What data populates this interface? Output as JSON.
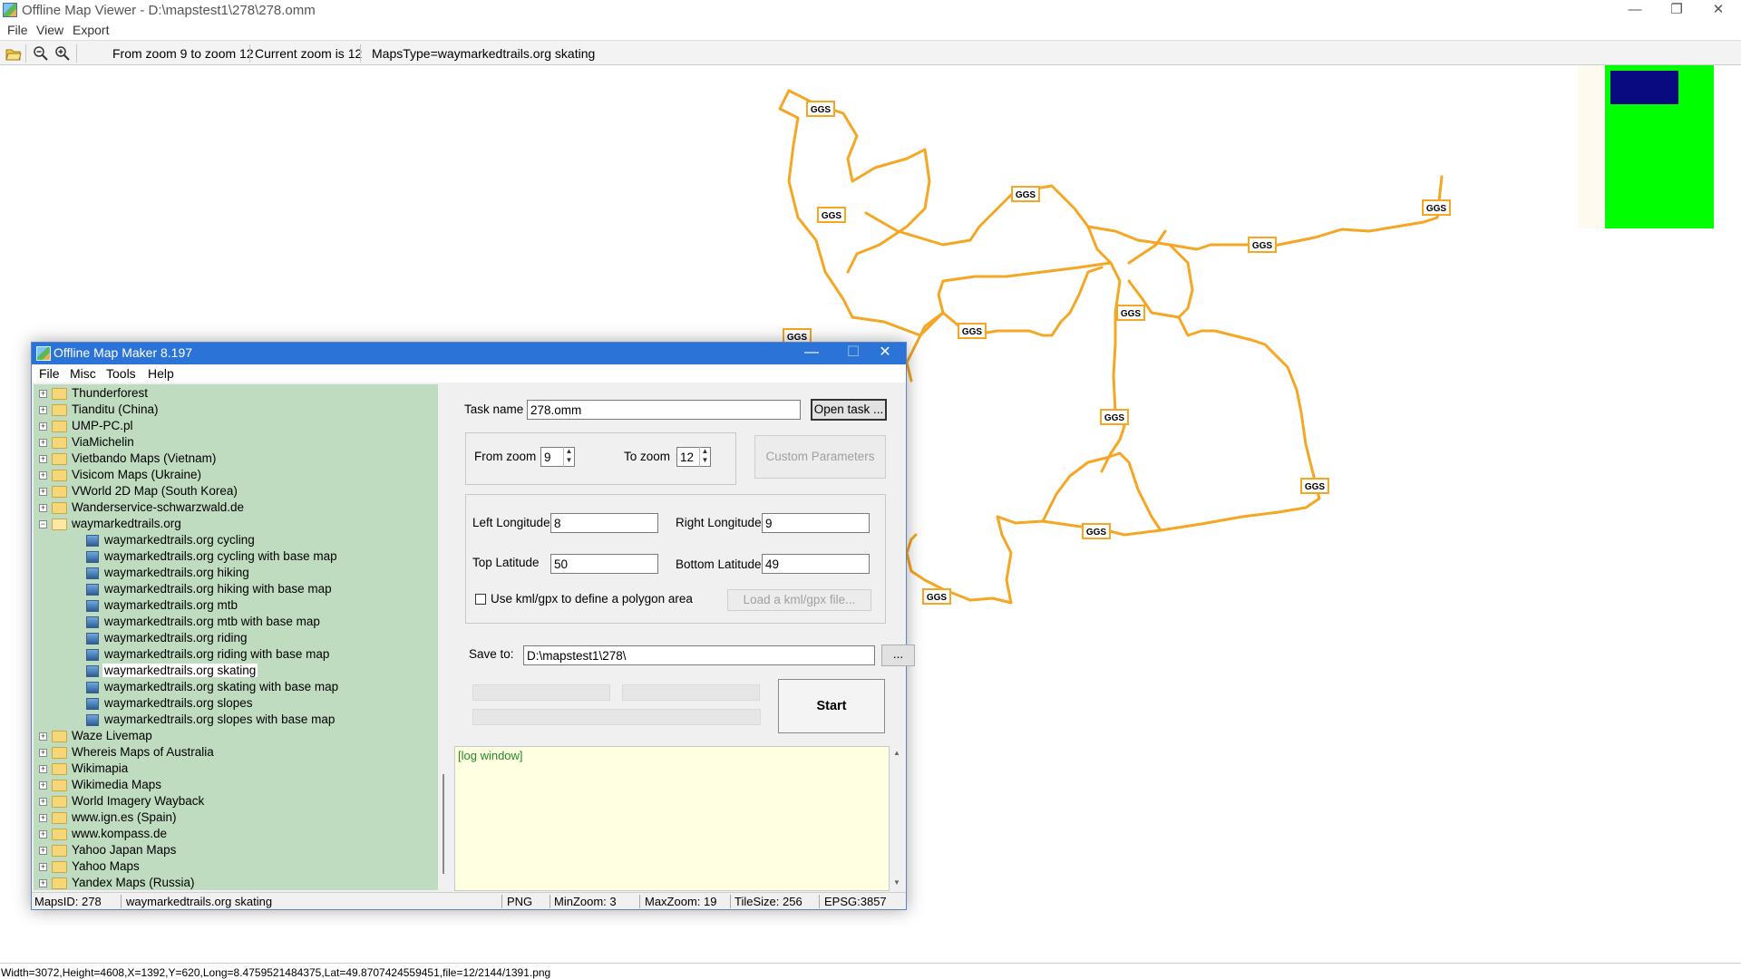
{
  "viewer": {
    "title": "Offline Map Viewer - D:\\mapstest1\\278\\278.omm",
    "menu": [
      "File",
      "View",
      "Export"
    ],
    "toolbar_info": {
      "zoom_range": "From zoom 9 to zoom 12",
      "current_zoom": "Current zoom is 12",
      "maps_type": "MapsType=waymarkedtrails.org skating"
    },
    "map_label": "GGS",
    "status": "Width=3072,Height=4608,X=1392,Y=620,Long=8.4759521484375,Lat=49.8707424559451,file=12/2144/1391.png",
    "colors": {
      "trail": "#f5a623",
      "minimap_bg": "#00ff00",
      "minimap_view": "#0a0a80"
    }
  },
  "maker": {
    "title": "Offline Map Maker 8.197",
    "menu": [
      "File",
      "Misc",
      "Tools",
      "Help"
    ],
    "tree_top": [
      "Thunderforest",
      "Tianditu (China)",
      "UMP-PC.pl",
      "ViaMichelin",
      "Vietbando Maps (Vietnam)",
      "Visicom Maps (Ukraine)",
      "VWorld 2D Map (South Korea)",
      "Wanderservice-schwarzwald.de"
    ],
    "tree_expanded": "waymarkedtrails.org",
    "tree_children": [
      "waymarkedtrails.org cycling",
      "waymarkedtrails.org cycling with base map",
      "waymarkedtrails.org hiking",
      "waymarkedtrails.org hiking with base map",
      "waymarkedtrails.org mtb",
      "waymarkedtrails.org mtb with base map",
      "waymarkedtrails.org riding",
      "waymarkedtrails.org riding with base map",
      "waymarkedtrails.org skating",
      "waymarkedtrails.org skating with base map",
      "waymarkedtrails.org slopes",
      "waymarkedtrails.org slopes with base map"
    ],
    "tree_selected_index": 8,
    "tree_bottom": [
      "Waze Livemap",
      "Whereis Maps of Australia",
      "Wikimapia",
      "Wikimedia Maps",
      "World Imagery Wayback",
      "www.ign.es (Spain)",
      "www.kompass.de",
      "Yahoo Japan Maps",
      "Yahoo Maps",
      "Yandex Maps (Russia)"
    ],
    "form": {
      "task_name_label": "Task name",
      "task_name": "278.omm",
      "open_task": "Open task ...",
      "from_zoom_label": "From zoom",
      "from_zoom": "9",
      "to_zoom_label": "To zoom",
      "to_zoom": "12",
      "custom_params": "Custom Parameters",
      "left_lon_label": "Left Longitude",
      "left_lon": "8",
      "right_lon_label": "Right Longitude",
      "right_lon": "9",
      "top_lat_label": "Top Latitude",
      "top_lat": "50",
      "bottom_lat_label": "Bottom Latitude",
      "bottom_lat": "49",
      "kml_check": "Use kml/gpx to define a polygon area",
      "load_kml": "Load a kml/gpx file...",
      "save_label": "Save to:",
      "save_path": "D:\\mapstest1\\278\\",
      "browse": "...",
      "start": "Start"
    },
    "log": "[log window]",
    "status": {
      "maps_id": "MapsID: 278",
      "name": "waymarkedtrails.org skating",
      "format": "PNG",
      "min_zoom": "MinZoom: 3",
      "max_zoom": "MaxZoom: 19",
      "tile_size": "TileSize: 256",
      "epsg": "EPSG:3857"
    }
  }
}
